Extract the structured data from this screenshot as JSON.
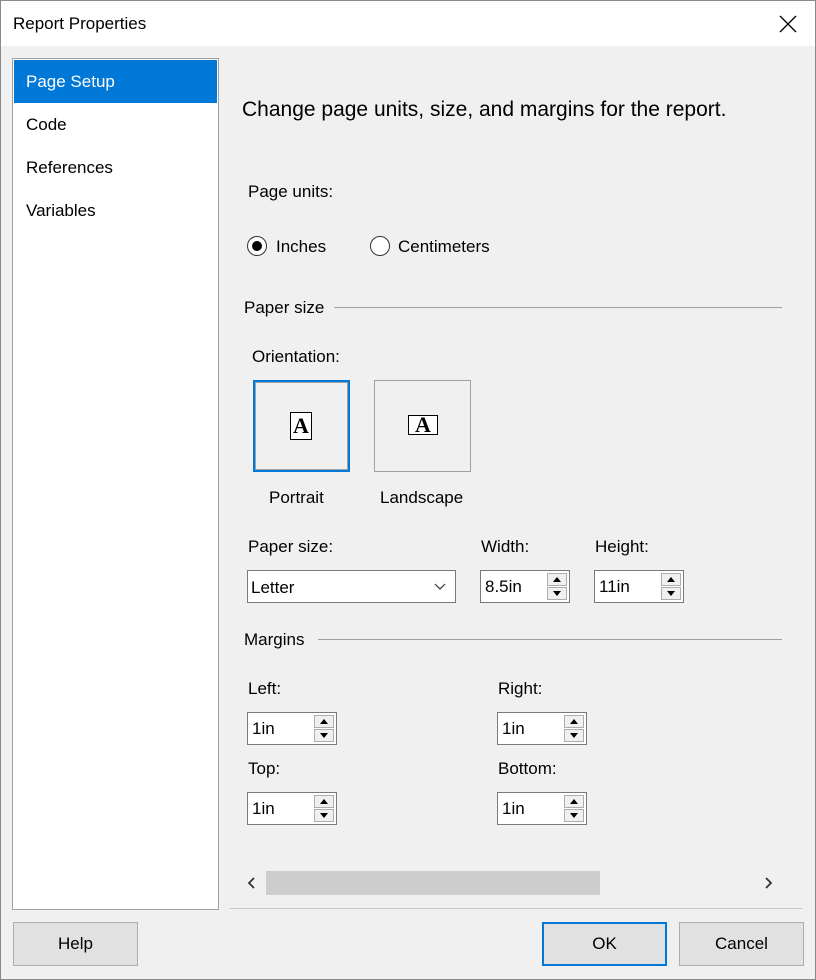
{
  "window": {
    "title": "Report Properties"
  },
  "nav": {
    "items": [
      {
        "label": "Page Setup",
        "selected": true
      },
      {
        "label": "Code",
        "selected": false
      },
      {
        "label": "References",
        "selected": false
      },
      {
        "label": "Variables",
        "selected": false
      }
    ]
  },
  "page": {
    "heading": "Change page units, size, and margins for the report.",
    "page_units_label": "Page units:",
    "units": [
      {
        "label": "Inches",
        "checked": true
      },
      {
        "label": "Centimeters",
        "checked": false
      }
    ]
  },
  "paper": {
    "group_label": "Paper size",
    "orientation_label": "Orientation:",
    "orientations": [
      {
        "label": "Portrait",
        "glyph": "A",
        "selected": true
      },
      {
        "label": "Landscape",
        "glyph": "A",
        "selected": false
      }
    ],
    "paper_size_label": "Paper size:",
    "paper_size_value": "Letter",
    "width_label": "Width:",
    "width_value": "8.5in",
    "height_label": "Height:",
    "height_value": "11in"
  },
  "margins": {
    "group_label": "Margins",
    "left_label": "Left:",
    "left_value": "1in",
    "right_label": "Right:",
    "right_value": "1in",
    "top_label": "Top:",
    "top_value": "1in",
    "bottom_label": "Bottom:",
    "bottom_value": "1in"
  },
  "buttons": {
    "help": "Help",
    "ok": "OK",
    "cancel": "Cancel"
  },
  "colors": {
    "accent": "#0078d7",
    "dialog_bg": "#f0f0f0"
  }
}
